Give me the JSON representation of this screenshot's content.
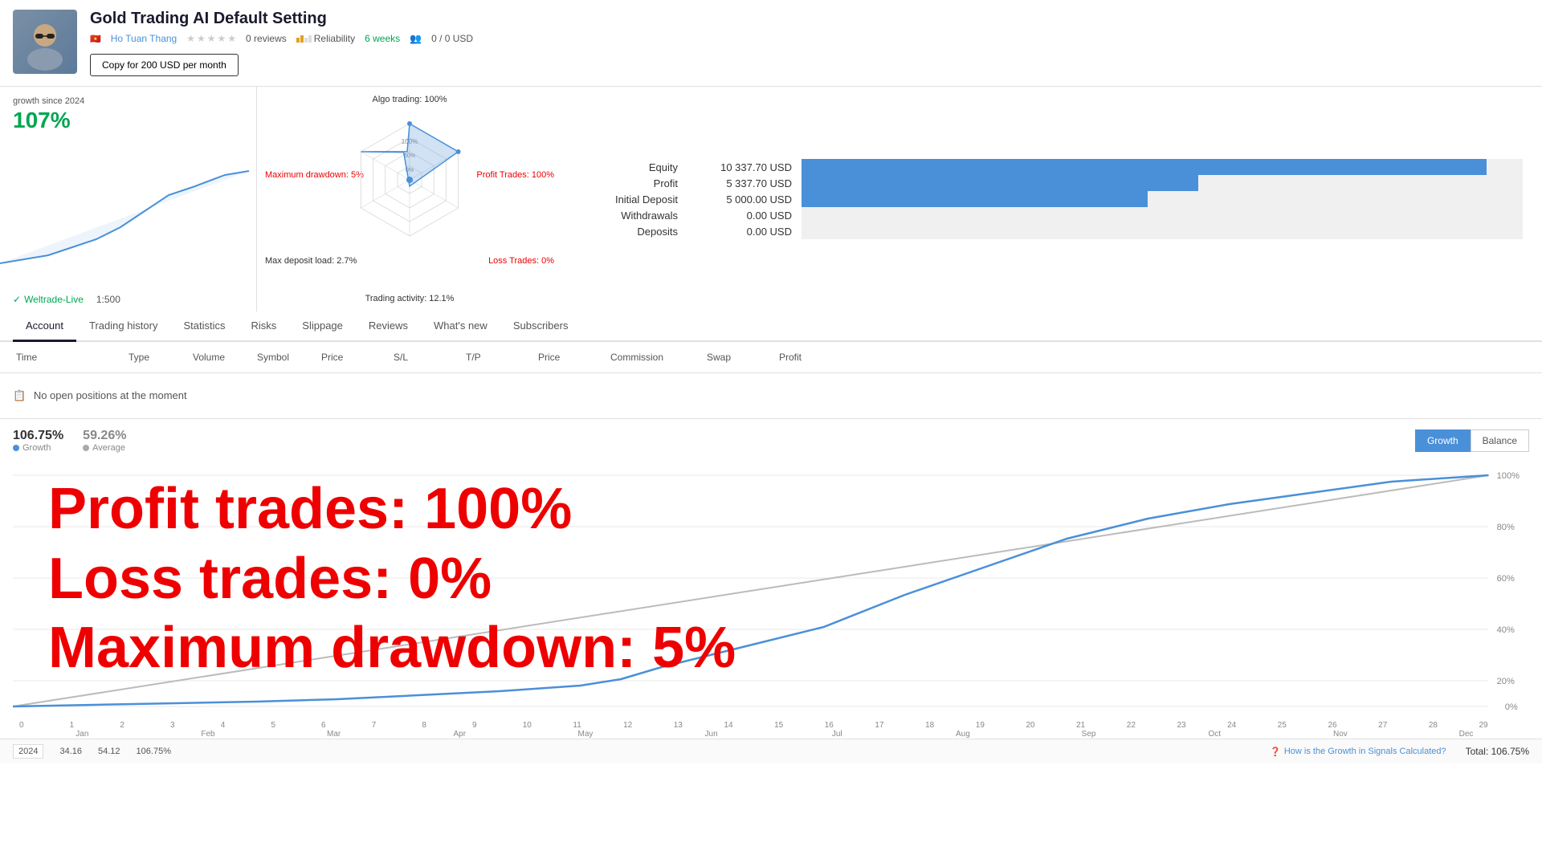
{
  "header": {
    "title": "Gold Trading AI Default Setting",
    "author": "Ho Tuan Thang",
    "reviews": "0 reviews",
    "reliability_label": "Reliability",
    "duration": "6 weeks",
    "subscribers": "0 / 0 USD",
    "copy_btn": "Copy for 200 USD per month"
  },
  "growth": {
    "since_label": "growth since 2024",
    "value": "107%"
  },
  "broker": {
    "name": "Weltrade-Live",
    "leverage": "1:500"
  },
  "radar": {
    "algo_trading": "Algo trading: 100%",
    "profit_trades": "Profit Trades: 100%",
    "loss_trades": "Loss Trades: 0%",
    "trading_activity": "Trading activity: 12.1%",
    "max_drawdown": "Maximum drawdown: 5%",
    "max_deposit_load": "Max deposit load: 2.7%"
  },
  "equity": {
    "rows": [
      {
        "label": "Equity",
        "value": "10 337.70 USD",
        "bar_pct": 95
      },
      {
        "label": "Profit",
        "value": "5 337.70 USD",
        "bar_pct": 55
      },
      {
        "label": "Initial Deposit",
        "value": "5 000.00 USD",
        "bar_pct": 48
      },
      {
        "label": "Withdrawals",
        "value": "0.00 USD",
        "bar_pct": 0
      },
      {
        "label": "Deposits",
        "value": "0.00 USD",
        "bar_pct": 0
      }
    ]
  },
  "tabs": [
    {
      "label": "Account",
      "active": true
    },
    {
      "label": "Trading history",
      "active": false
    },
    {
      "label": "Statistics",
      "active": false
    },
    {
      "label": "Risks",
      "active": false
    },
    {
      "label": "Slippage",
      "active": false
    },
    {
      "label": "Reviews",
      "active": false
    },
    {
      "label": "What's new",
      "active": false
    },
    {
      "label": "Subscribers",
      "active": false
    }
  ],
  "table": {
    "columns": [
      "Time",
      "Type",
      "Volume",
      "Symbol",
      "Price",
      "S/L",
      "T/P",
      "Price",
      "Commission",
      "Swap",
      "Profit"
    ]
  },
  "open_positions": "No open positions at the moment",
  "chart": {
    "growth_val": "106.75%",
    "growth_lbl": "Growth",
    "avg_val": "59.26%",
    "avg_lbl": "Average",
    "toggle_growth": "Growth",
    "toggle_balance": "Balance",
    "y_labels": [
      "100%",
      "80%",
      "60%",
      "40%",
      "20%",
      "0%"
    ],
    "x_numbers": [
      "0",
      "1",
      "2",
      "3",
      "4",
      "5",
      "6",
      "7",
      "8",
      "9",
      "10",
      "11",
      "12",
      "13",
      "14",
      "15",
      "16",
      "17",
      "18",
      "19",
      "20",
      "21",
      "22",
      "23",
      "24",
      "25",
      "26",
      "27",
      "28",
      "29"
    ],
    "months": [
      "Jan",
      "Feb",
      "Mar",
      "Apr",
      "May",
      "Jun",
      "Jul",
      "Aug",
      "Sep",
      "Oct",
      "Nov",
      "Dec"
    ],
    "year": "2024",
    "data_points": [
      {
        "label": "34.16",
        "pos": 40
      },
      {
        "label": "54.12",
        "pos": 62
      },
      {
        "label": "106.75%",
        "pos": 100
      }
    ]
  },
  "overlay": {
    "line1": "Profit trades: 100%",
    "line2": "Loss trades: 0%",
    "line3": "Maximum drawdown: 5%"
  },
  "footer": {
    "help_text": "How is the Growth in Signals Calculated?",
    "total_label": "Total: 106.75%"
  }
}
